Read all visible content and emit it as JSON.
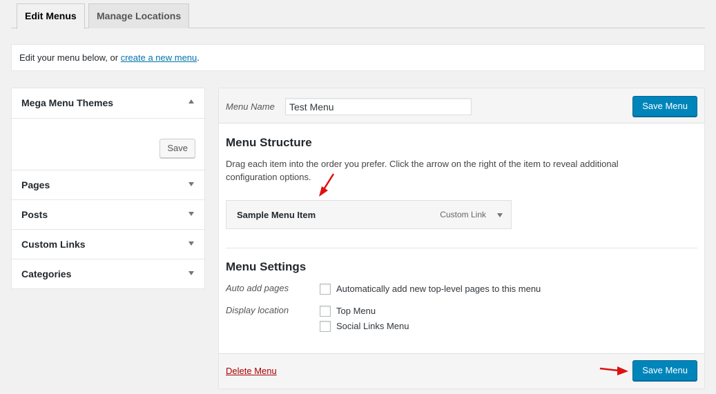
{
  "tabs": [
    {
      "label": "Edit Menus",
      "active": true
    },
    {
      "label": "Manage Locations",
      "active": false
    }
  ],
  "notice": {
    "text": "Edit your menu below, or ",
    "link": "create a new menu",
    "suffix": "."
  },
  "sidebar": {
    "sections": [
      {
        "label": "Mega Menu Themes",
        "expanded": true,
        "button": "Save"
      },
      {
        "label": "Pages",
        "expanded": false
      },
      {
        "label": "Posts",
        "expanded": false
      },
      {
        "label": "Custom Links",
        "expanded": false
      },
      {
        "label": "Categories",
        "expanded": false
      }
    ]
  },
  "main": {
    "menu_name_label": "Menu Name",
    "menu_name_value": "Test Menu",
    "save_label": "Save Menu",
    "structure_title": "Menu Structure",
    "structure_help": "Drag each item into the order you prefer. Click the arrow on the right of the item to reveal additional configuration options.",
    "item": {
      "title": "Sample Menu Item",
      "type": "Custom Link"
    },
    "settings_title": "Menu Settings",
    "auto_add_label": "Auto add pages",
    "auto_add_option": "Automatically add new top-level pages to this menu",
    "display_location_label": "Display location",
    "locations": [
      "Top Menu",
      "Social Links Menu"
    ],
    "delete_label": "Delete Menu"
  },
  "colors": {
    "primary": "#0085ba",
    "delete": "#aa0000",
    "annotation": "#dd1111"
  },
  "icons": [
    "chevron-up-icon",
    "chevron-down-icon",
    "red-arrow-annotation"
  ]
}
